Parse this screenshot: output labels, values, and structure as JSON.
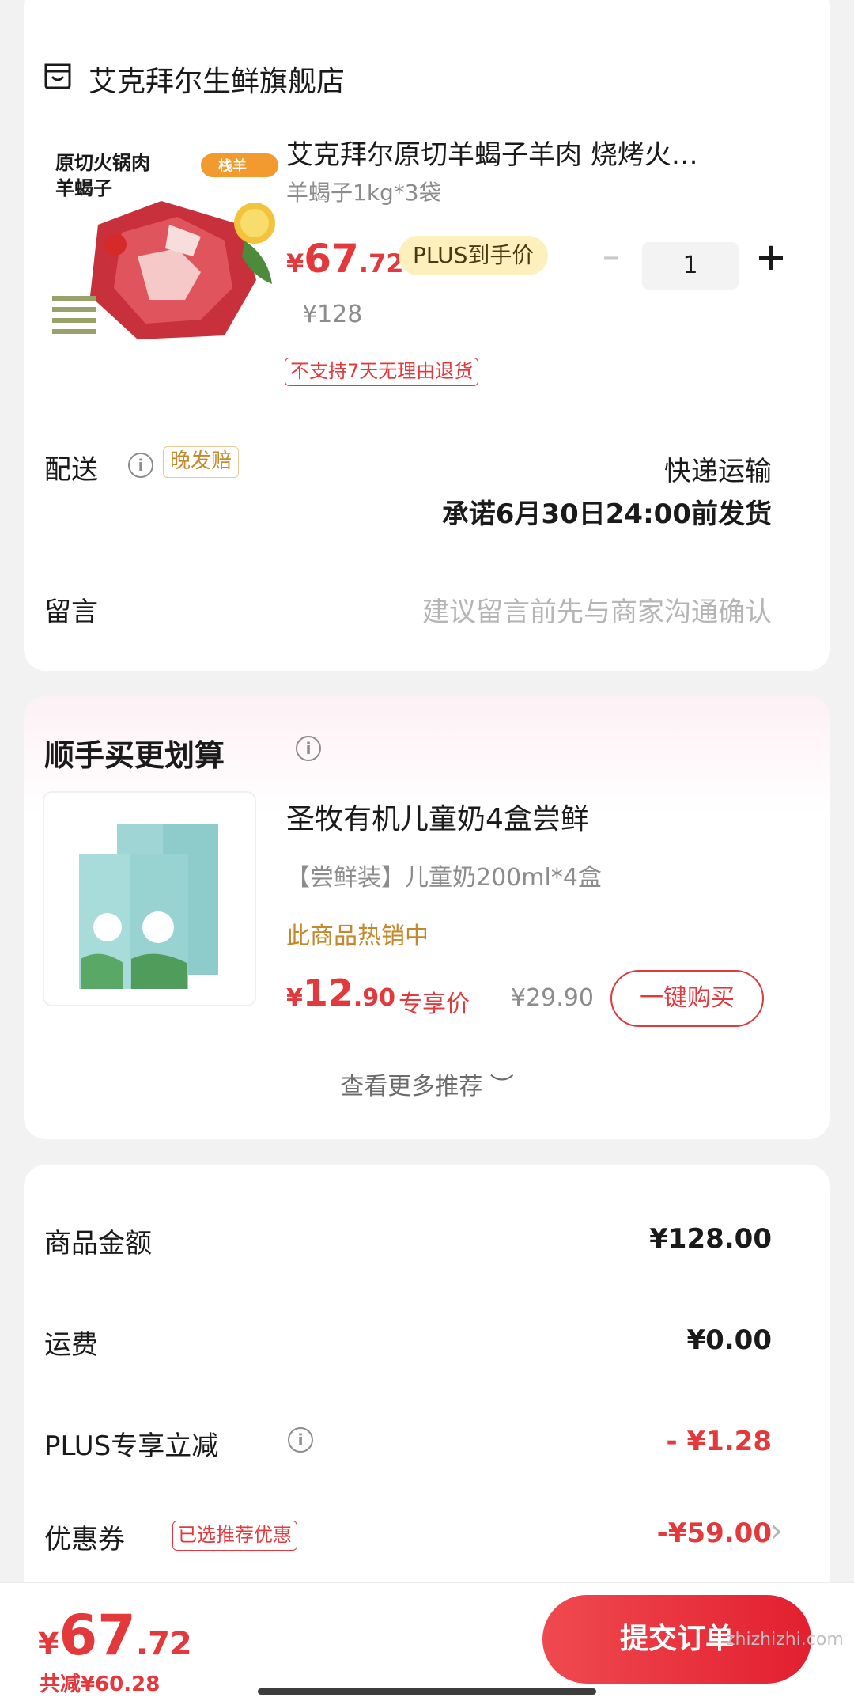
{
  "store": {
    "name": "艾克拜尔生鲜旗舰店"
  },
  "product": {
    "image_text": [
      "原切火锅肉",
      "羊蝎子",
      "栈羊"
    ],
    "title": "艾克拜尔原切羊蝎子羊肉 烧烤火…",
    "spec": "羊蝎子1kg*3袋",
    "price": {
      "symbol": "¥",
      "int": "67",
      "dec": ".72"
    },
    "plus_tag": "PLUS到手价",
    "quantity": "1",
    "orig_price": "¥128",
    "return_note": "不支持7天无理由退货"
  },
  "delivery": {
    "label": "配送",
    "late_tag": "晚发赔",
    "method": "快递运输",
    "promise": "承诺6月30日24:00前发货"
  },
  "memo": {
    "label": "留言",
    "placeholder": "建议留言前先与商家沟通确认"
  },
  "recommend": {
    "title": "顺手买更划算",
    "item": {
      "name": "圣牧有机儿童奶4盒尝鲜",
      "spec": "【尝鲜装】儿童奶200ml*4盒",
      "hot": "此商品热销中",
      "price": {
        "symbol": "¥",
        "int": "12",
        "dec": ".90"
      },
      "exclusive": "专享价",
      "orig_price": "¥29.90",
      "buy_label": "一键购买"
    },
    "more": "查看更多推荐 ︶"
  },
  "summary": {
    "goods_label": "商品金额",
    "goods_value": "¥128.00",
    "freight_label": "运费",
    "freight_value": "¥0.00",
    "plus_label": "PLUS专享立减",
    "plus_value": "- ¥1.28",
    "coupon_label": "优惠券",
    "coupon_tag": "已选推荐优惠",
    "coupon_value": "-¥59.00"
  },
  "bottom": {
    "total": {
      "symbol": "¥",
      "int": "67",
      "dec": ".72"
    },
    "saved": "共减¥60.28",
    "submit": "提交订单",
    "watermark": "zhizhizhi.com"
  },
  "colors": {
    "accent": "#e4393c",
    "plus_tag_bg": "#fdf0bd",
    "late_tag": "#c28a2e"
  }
}
